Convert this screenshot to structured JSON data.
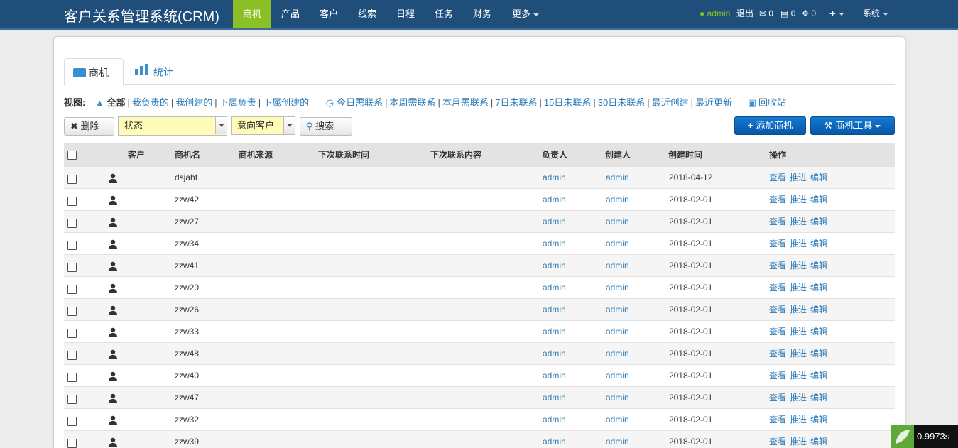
{
  "app": {
    "title": "客户关系管理系统(CRM)"
  },
  "nav": {
    "items": [
      "商机",
      "产品",
      "客户",
      "线索",
      "日程",
      "任务",
      "财务",
      "更多"
    ],
    "user": "admin",
    "logout": "退出",
    "mail_count": "0",
    "msg_count": "0",
    "notice_count": "0",
    "system": "系统"
  },
  "tabs": [
    "商机",
    "统计"
  ],
  "views": {
    "label": "视图:",
    "all": "全部",
    "group1": [
      "我负责的",
      "我创建的",
      "下属负责",
      "下属创建的"
    ],
    "group2": [
      "今日需联系",
      "本周需联系",
      "本月需联系",
      "7日未联系",
      "15日未联系",
      "30日未联系",
      "最近创建",
      "最近更新"
    ],
    "recycle": "回收站"
  },
  "toolbar": {
    "delete": "删除",
    "status_select": "状态",
    "customer_select": "意向客户",
    "search": "搜索",
    "add": "添加商机",
    "tools": "商机工具"
  },
  "table": {
    "headers": [
      "客户",
      "商机名",
      "商机来源",
      "下次联系时间",
      "下次联系内容",
      "负责人",
      "创建人",
      "创建时间",
      "操作"
    ],
    "ops": [
      "查看",
      "推进",
      "编辑"
    ],
    "rows": [
      {
        "name": "dsjahf",
        "owner": "admin",
        "creator": "admin",
        "created": "2018-04-12"
      },
      {
        "name": "zzw42",
        "owner": "admin",
        "creator": "admin",
        "created": "2018-02-01"
      },
      {
        "name": "zzw27",
        "owner": "admin",
        "creator": "admin",
        "created": "2018-02-01"
      },
      {
        "name": "zzw34",
        "owner": "admin",
        "creator": "admin",
        "created": "2018-02-01"
      },
      {
        "name": "zzw41",
        "owner": "admin",
        "creator": "admin",
        "created": "2018-02-01"
      },
      {
        "name": "zzw20",
        "owner": "admin",
        "creator": "admin",
        "created": "2018-02-01"
      },
      {
        "name": "zzw26",
        "owner": "admin",
        "creator": "admin",
        "created": "2018-02-01"
      },
      {
        "name": "zzw33",
        "owner": "admin",
        "creator": "admin",
        "created": "2018-02-01"
      },
      {
        "name": "zzw48",
        "owner": "admin",
        "creator": "admin",
        "created": "2018-02-01"
      },
      {
        "name": "zzw40",
        "owner": "admin",
        "creator": "admin",
        "created": "2018-02-01"
      },
      {
        "name": "zzw47",
        "owner": "admin",
        "creator": "admin",
        "created": "2018-02-01"
      },
      {
        "name": "zzw32",
        "owner": "admin",
        "creator": "admin",
        "created": "2018-02-01"
      },
      {
        "name": "zzw39",
        "owner": "admin",
        "creator": "admin",
        "created": "2018-02-01"
      }
    ]
  },
  "timer": "0.9973s"
}
